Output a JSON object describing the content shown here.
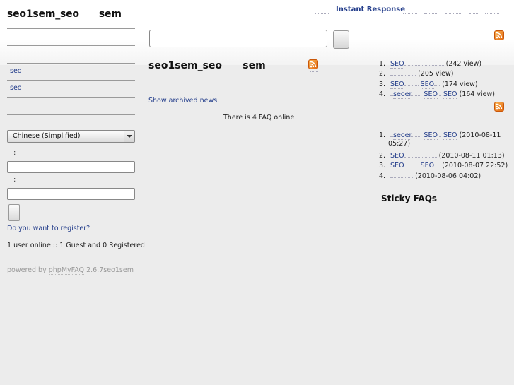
{
  "site": {
    "title": "seo1sem_seo      sem"
  },
  "nav": {
    "instant_response": "Instant Response"
  },
  "sidebar": {
    "categories": [
      "seo",
      "seo"
    ],
    "language_selected": "Chinese (Simplified)",
    "login": {
      "user_label": ":",
      "pass_label": ":",
      "register_link": "Do you want to register?"
    },
    "online_status": "1 user online :: 1 Guest and 0 Registered"
  },
  "main": {
    "news_title": "seo1sem_seo      sem",
    "archived_link": "Show archived news.",
    "faq_online": "There is 4 FAQ online"
  },
  "popular": [
    {
      "num": "1.",
      "link": "SEO",
      "suffix": "(242 view)"
    },
    {
      "num": "2.",
      "link": "",
      "suffix": "(205 view)"
    },
    {
      "num": "3.",
      "link": "SEO",
      "link2": "SEO",
      "suffix": "(174 view)"
    },
    {
      "num": "4.",
      "link": "seoer",
      "link2": "SEO",
      "link3": "SEO",
      "suffix": "(164 view)"
    }
  ],
  "latest": [
    {
      "num": "1.",
      "link": "seoer",
      "link2": "SEO",
      "link3": "SEO",
      "date_a": "(2010-08-11",
      "date_b": "05:27)"
    },
    {
      "num": "2.",
      "link": "SEO",
      "date": "(2010-08-11 01:13)"
    },
    {
      "num": "3.",
      "link": "SEO",
      "link2": "SEO",
      "date": "(2010-08-07 22:52)"
    },
    {
      "num": "4.",
      "link": "",
      "date": "(2010-08-06 04:02)"
    }
  ],
  "sticky_title": "Sticky FAQs",
  "footer": {
    "powered": "powered by",
    "product": "phpMyFAQ",
    "version": "2.6.7seo1sem"
  },
  "icons": {
    "feed": "rss-icon"
  },
  "colors": {
    "link": "#223c8a",
    "background": "#ececec",
    "rss": "#f08a24"
  }
}
